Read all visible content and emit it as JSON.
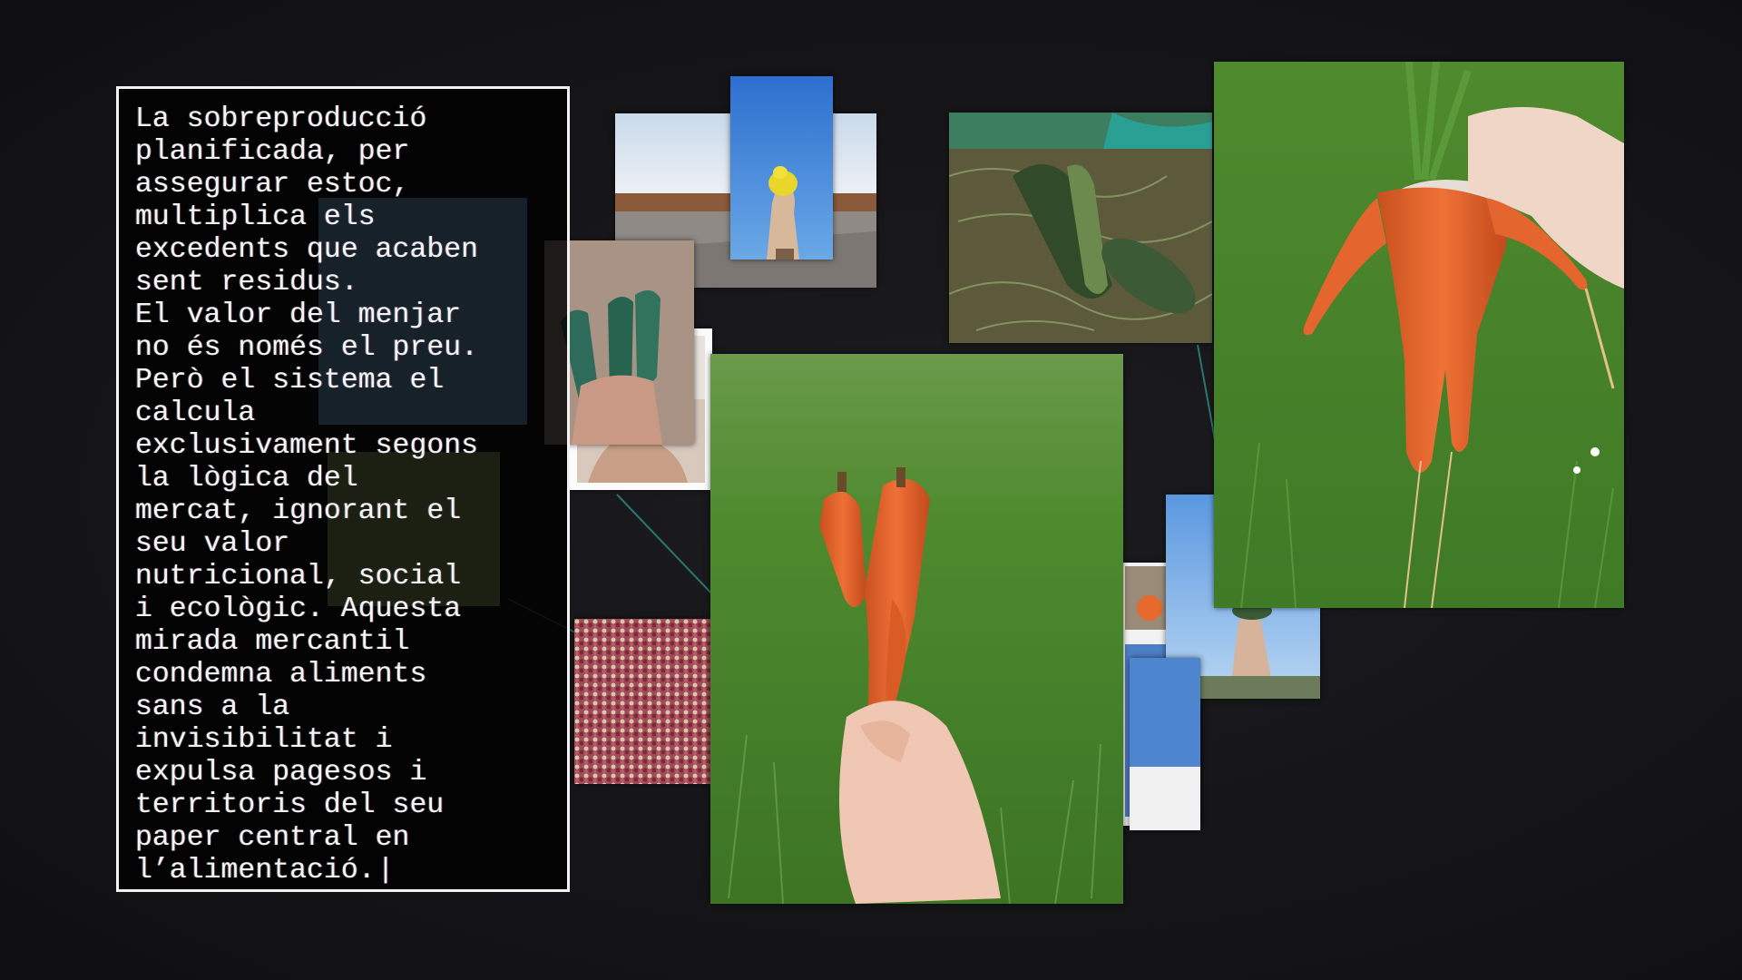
{
  "panel": {
    "lines": [
      "La sobreproducció",
      "planificada, per",
      "assegurar estoc,",
      "multiplica els",
      "excedents que acaben",
      "sent residus.",
      "El valor del menjar",
      "no és només el preu.",
      "Però el sistema el",
      "calcula",
      "exclusivament segons",
      "la lògica del",
      "mercat, ignorant el",
      "seu valor",
      "nutricional, social",
      "i ecològic. Aquesta",
      "mirada mercantil",
      "condemna aliments",
      "sans a la",
      "invisibilitat i",
      "expulsa pagesos i",
      "territoris del seu",
      "paper central en",
      "l’alimentació."
    ],
    "cursor": "|"
  },
  "colors": {
    "background": "#161619",
    "panel_border": "#f2f2f2",
    "text": "#f4f4f4",
    "connector": "#2f8f86",
    "carrot": "#e8662e",
    "grass": "#4f8a2e",
    "sky": "#4d8fd6"
  },
  "photos": [
    {
      "name": "photo-field-sky",
      "subject": "field-under-sky"
    },
    {
      "name": "photo-yellow-fruit-held-up",
      "subject": "yellow-fruit-against-sky"
    },
    {
      "name": "photo-cucumbers-in-hand",
      "subject": "cucumbers-held-in-hand"
    },
    {
      "name": "photo-hand-closeup",
      "subject": "hand"
    },
    {
      "name": "photo-zucchini-on-ground",
      "subject": "zucchini-in-soil"
    },
    {
      "name": "photo-twisted-carrot",
      "subject": "twisted-carrot-held-over-grass"
    },
    {
      "name": "photo-forked-carrot",
      "subject": "forked-carrot-held-over-grass"
    },
    {
      "name": "photo-beans-pile",
      "subject": "pile-of-beans"
    },
    {
      "name": "photo-hand-raised-sky",
      "subject": "hand-raised-against-sky"
    },
    {
      "name": "photo-small-sky",
      "subject": "sky-fragment"
    },
    {
      "name": "photo-small-people",
      "subject": "people-fragment"
    }
  ]
}
